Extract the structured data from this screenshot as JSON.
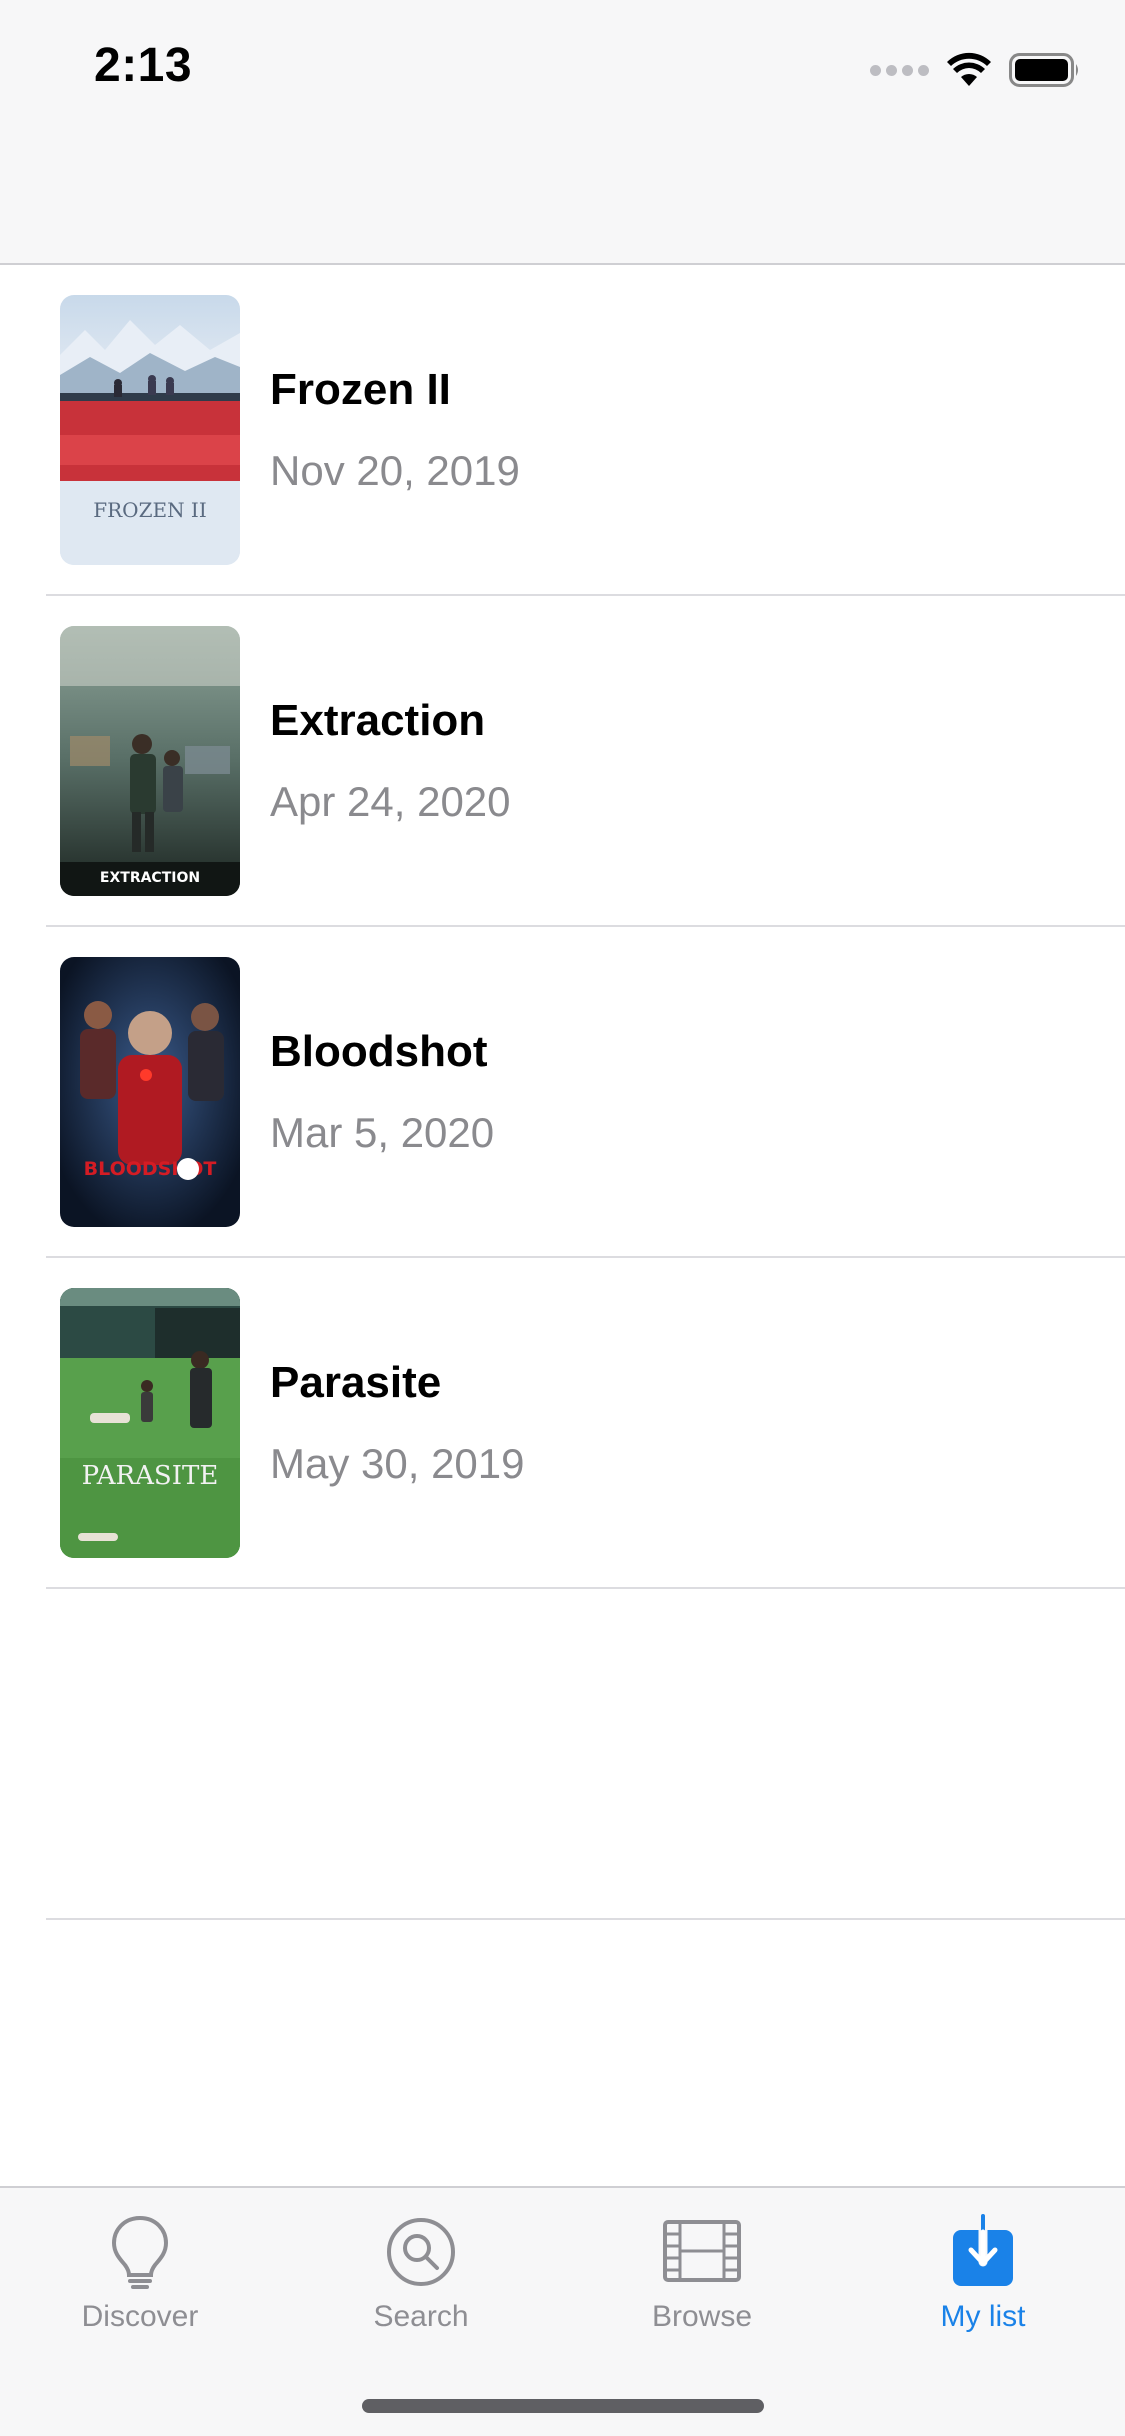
{
  "status_bar": {
    "time": "2:13",
    "icons": [
      "cellular-signal-icon",
      "wifi-icon",
      "battery-icon"
    ]
  },
  "movies": [
    {
      "title": "Frozen II",
      "date": "Nov 20, 2019",
      "poster_text": "FROZEN II"
    },
    {
      "title": "Extraction",
      "date": "Apr 24, 2020",
      "poster_text": "EXTRACTION"
    },
    {
      "title": "Bloodshot",
      "date": "Mar 5, 2020",
      "poster_text": "BLOODSHOT"
    },
    {
      "title": "Parasite",
      "date": "May 30, 2019",
      "poster_text": "PARASITE"
    }
  ],
  "tab_bar": {
    "active_color": "#1a82e8",
    "inactive_color": "#8e8e93",
    "tabs": [
      {
        "label": "Discover",
        "icon": "lightbulb-icon",
        "active": false
      },
      {
        "label": "Search",
        "icon": "magnifier-icon",
        "active": false
      },
      {
        "label": "Browse",
        "icon": "film-strip-icon",
        "active": false
      },
      {
        "label": "My list",
        "icon": "download-arrow-icon",
        "active": true
      }
    ]
  }
}
